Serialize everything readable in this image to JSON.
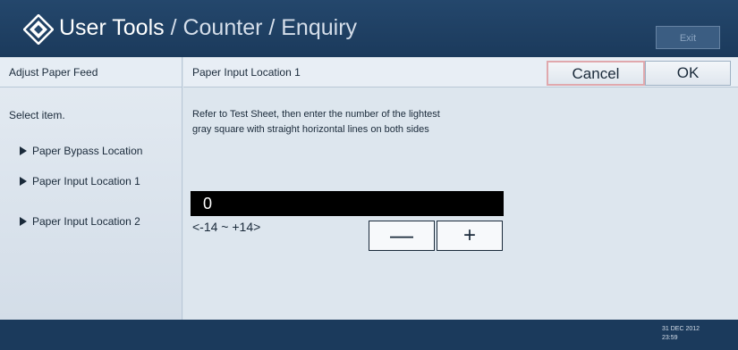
{
  "app": {
    "title_primary": "User Tools",
    "title_secondary": " / Counter / Enquiry",
    "exit_label": "Exit"
  },
  "sidebar": {
    "header": "Adjust Paper Feed",
    "select_label": "Select item.",
    "items": [
      {
        "label": "Paper Bypass Location"
      },
      {
        "label": "Paper Input Location 1"
      },
      {
        "label": "Paper Input Location 2"
      }
    ]
  },
  "main": {
    "title": "Paper Input Location 1",
    "cancel_label": "Cancel",
    "ok_label": "OK",
    "instruction_line1": "Refer to Test Sheet, then enter the number of the lightest",
    "instruction_line2": "gray square with straight horizontal lines on both sides",
    "value": "0",
    "range": "<-14 ~ +14>",
    "minus_label": "—",
    "plus_label": "+"
  },
  "status": {
    "date": "31 DEC 2012",
    "time": "23:59"
  },
  "colors": {
    "title_bar": "#1b3a5c",
    "panel": "#dde6ee",
    "display": "#000000"
  }
}
